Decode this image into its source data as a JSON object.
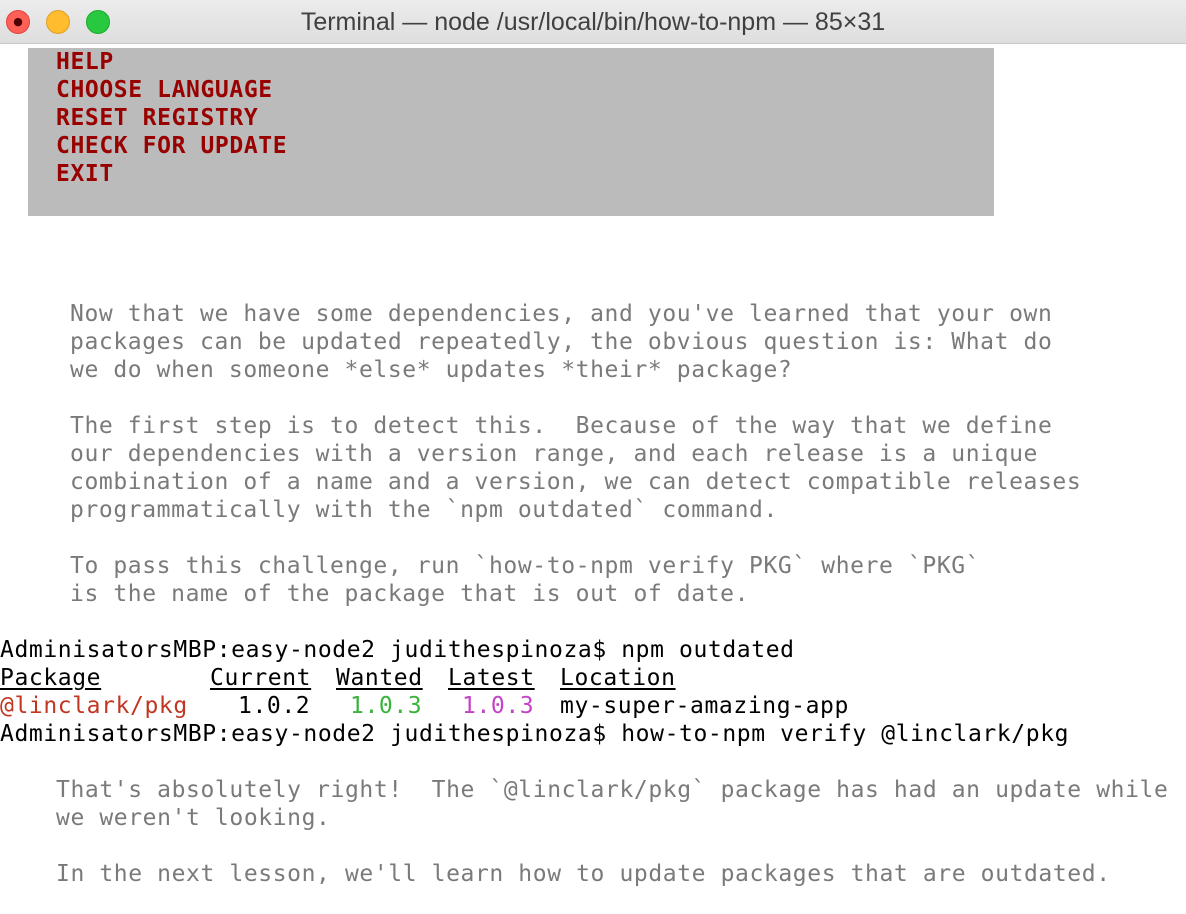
{
  "window": {
    "title": "Terminal — node /usr/local/bin/how-to-npm — 85×31"
  },
  "menu": {
    "items": [
      {
        "label": "HELP"
      },
      {
        "label": "CHOOSE LANGUAGE"
      },
      {
        "label": "RESET REGISTRY"
      },
      {
        "label": "CHECK FOR UPDATE"
      },
      {
        "label": "EXIT"
      }
    ]
  },
  "lesson": {
    "lines": [
      "Now that we have some dependencies, and you've learned that your own",
      "packages can be updated repeatedly, the obvious question is: What do",
      "we do when someone *else* updates *their* package?",
      "The first step is to detect this.  Because of the way that we define",
      "our dependencies with a version range, and each release is a unique",
      "combination of a name and a version, we can detect compatible releases",
      "programmatically with the `npm outdated` command.",
      "To pass this challenge, run `how-to-npm verify PKG` where `PKG`",
      "is the name of the package that is out of date."
    ]
  },
  "shell": {
    "prompt": "AdminisatorsMBP:easy-node2 judithespinoza$",
    "command1": "npm outdated",
    "command2": "how-to-npm verify @linclark/pkg"
  },
  "outdated_table": {
    "headers": [
      "Package",
      "Current",
      "Wanted",
      "Latest",
      "Location"
    ],
    "row": {
      "package": "@linclark/pkg",
      "current": "1.0.2",
      "wanted": "1.0.3",
      "latest": "1.0.3",
      "location": "my-super-amazing-app"
    }
  },
  "result": {
    "lines": [
      "That's absolutely right!  The `@linclark/pkg` package has had an update while",
      "we weren't looking.",
      "In the next lesson, we'll learn how to update packages that are outdated."
    ]
  },
  "colors": {
    "menu_background": "#bbbbbb",
    "menu_text": "#990000",
    "package_name": "#c23621",
    "wanted": "#3ab33a",
    "latest": "#c541c5",
    "lesson_text": "#7a7a7a"
  },
  "icons": [
    "close-icon",
    "minimize-icon",
    "zoom-icon"
  ]
}
